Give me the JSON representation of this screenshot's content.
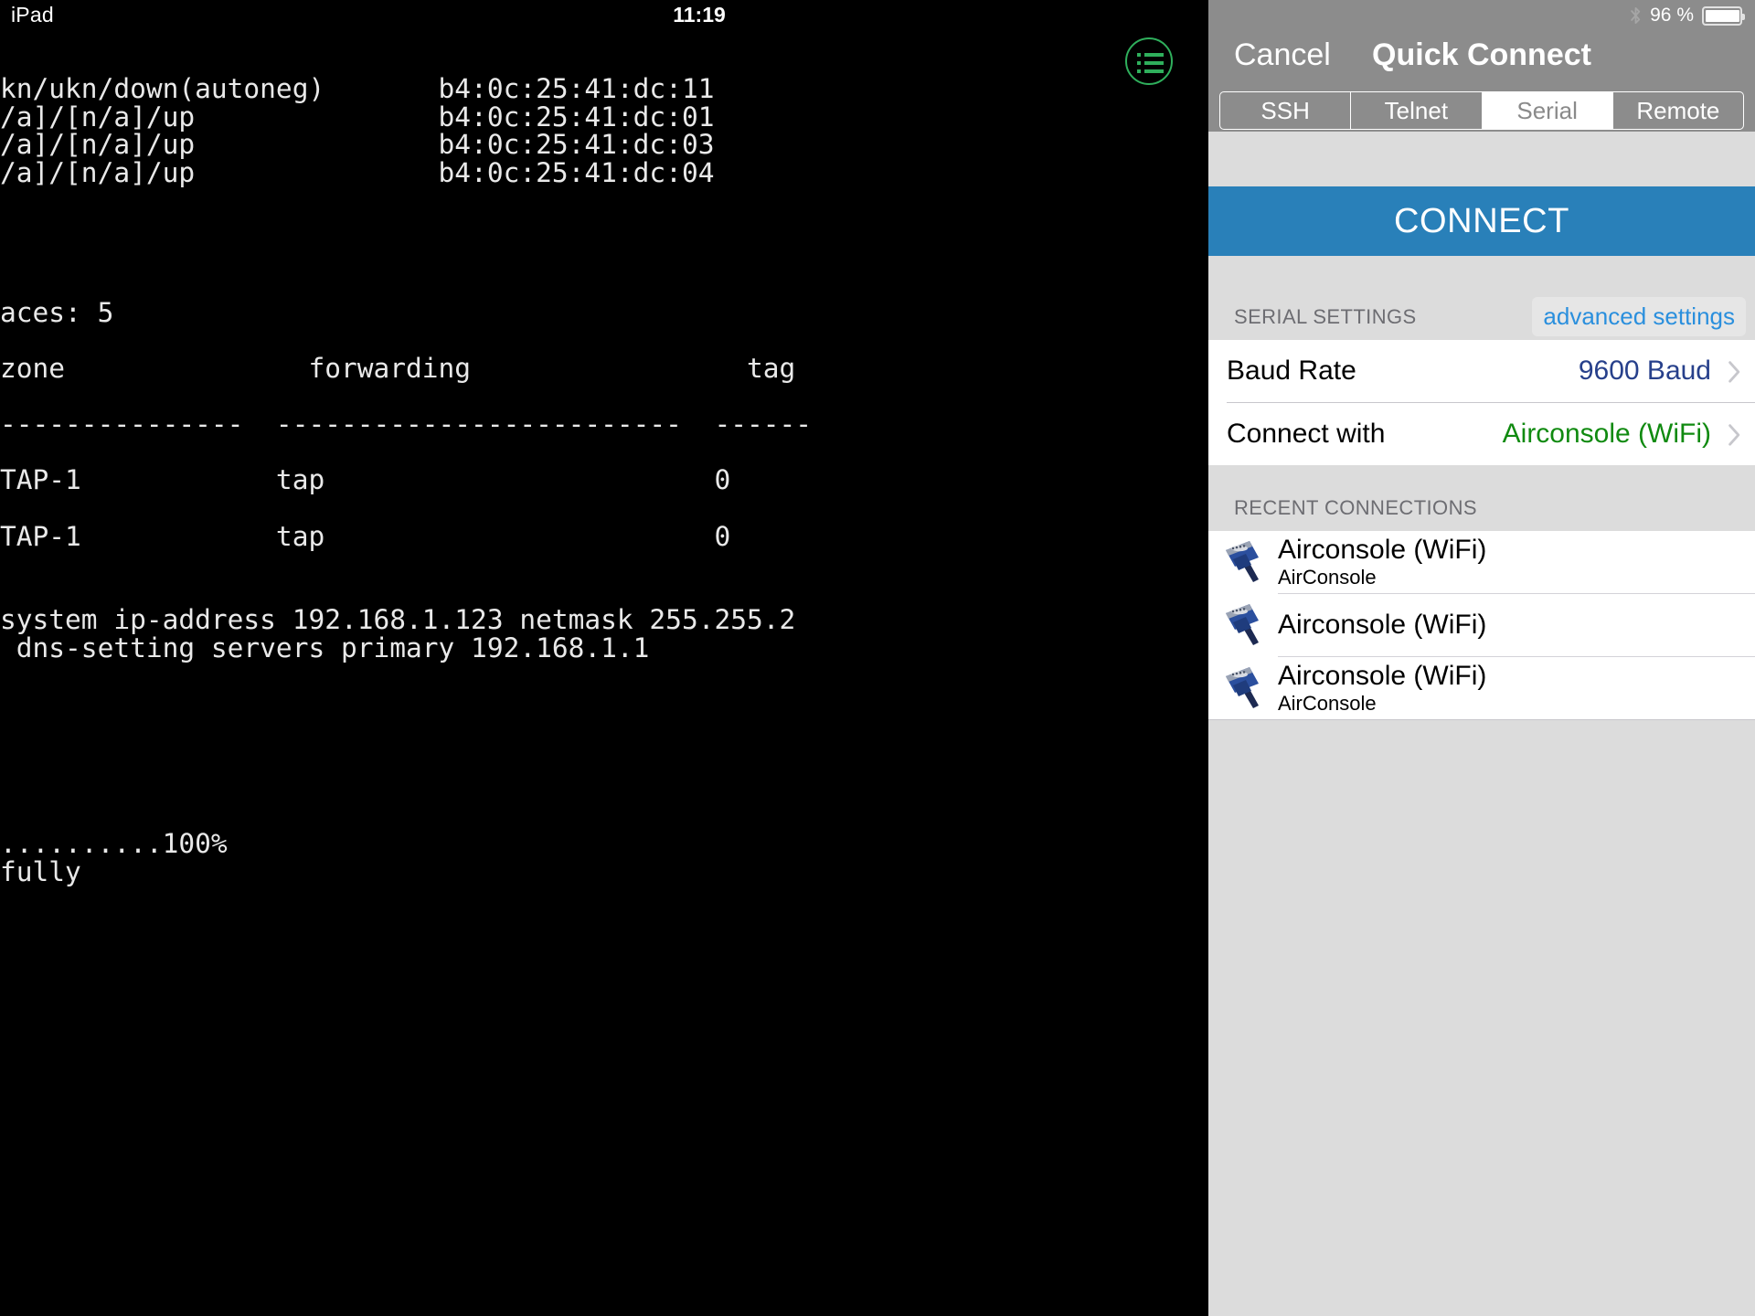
{
  "status_bar_left": {
    "device_name": "iPad",
    "time": "11:19"
  },
  "terminal": {
    "content": "                                                 \nkn/ukn/down(autoneg)       b4:0c:25:41:dc:11\n/a]/[n/a]/up               b4:0c:25:41:dc:01\n/a]/[n/a]/up               b4:0c:25:41:dc:03\n/a]/[n/a]/up               b4:0c:25:41:dc:04\n\n\n\n\naces: 5\n\nzone               forwarding                 tag\n\n---------------  -------------------------  ------\n\nTAP-1            tap                        0\n\nTAP-1            tap                        0\n\n\nsystem ip-address 192.168.1.123 netmask 255.255.2\n dns-setting servers primary 192.168.1.1\n\n\n\n\n\n\n..........100%\nfully",
    "menu_icon": "list-menu-icon"
  },
  "panel": {
    "status_bar": {
      "bluetooth_icon": "bluetooth-icon",
      "battery_percent": "96 %",
      "battery_icon": "battery-icon"
    },
    "nav": {
      "cancel_label": "Cancel",
      "title": "Quick Connect"
    },
    "segmented_control": {
      "options": [
        "SSH",
        "Telnet",
        "Serial",
        "Remote"
      ],
      "selected": "Serial"
    },
    "connect_button_label": "CONNECT",
    "serial_settings": {
      "header": "SERIAL SETTINGS",
      "advanced_label": "advanced settings",
      "rows": [
        {
          "label": "Baud Rate",
          "value": "9600 Baud",
          "value_color": "#27408b"
        },
        {
          "label": "Connect with",
          "value": "Airconsole (WiFi)",
          "value_color": "#108a10"
        }
      ]
    },
    "recent_connections": {
      "header": "RECENT CONNECTIONS",
      "items": [
        {
          "title": "Airconsole (WiFi)",
          "subtitle": "AirConsole",
          "icon": "serial-connector-icon"
        },
        {
          "title": "Airconsole (WiFi)",
          "subtitle": "",
          "icon": "serial-connector-icon"
        },
        {
          "title": "Airconsole (WiFi)",
          "subtitle": "AirConsole",
          "icon": "serial-connector-icon"
        }
      ]
    }
  },
  "colors": {
    "connect_blue": "#2980b9",
    "panel_gray": "#dcdcdc",
    "nav_gray": "#8c8c8c",
    "accent_green": "#2faf5c",
    "link_blue": "#2a8fdd"
  }
}
